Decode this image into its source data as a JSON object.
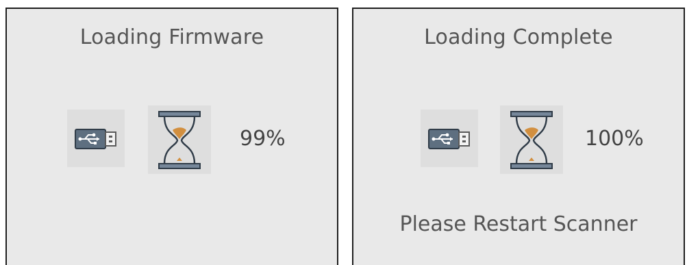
{
  "panels": [
    {
      "title": "Loading Firmware",
      "progress_text": "99%",
      "progress_value": 99,
      "message": "",
      "icons": [
        "usb-drive-icon",
        "hourglass-icon"
      ]
    },
    {
      "title": "Loading Complete",
      "progress_text": "100%",
      "progress_value": 100,
      "message": "Please Restart Scanner",
      "icons": [
        "usb-drive-icon",
        "hourglass-icon"
      ]
    }
  ],
  "colors": {
    "panel_background": "#e9e9e9",
    "icon_tile": "#dedede",
    "text": "#555555",
    "usb_body": "#5e6f80",
    "hourglass_frame": "#76879a",
    "sand": "#d28f3f"
  }
}
